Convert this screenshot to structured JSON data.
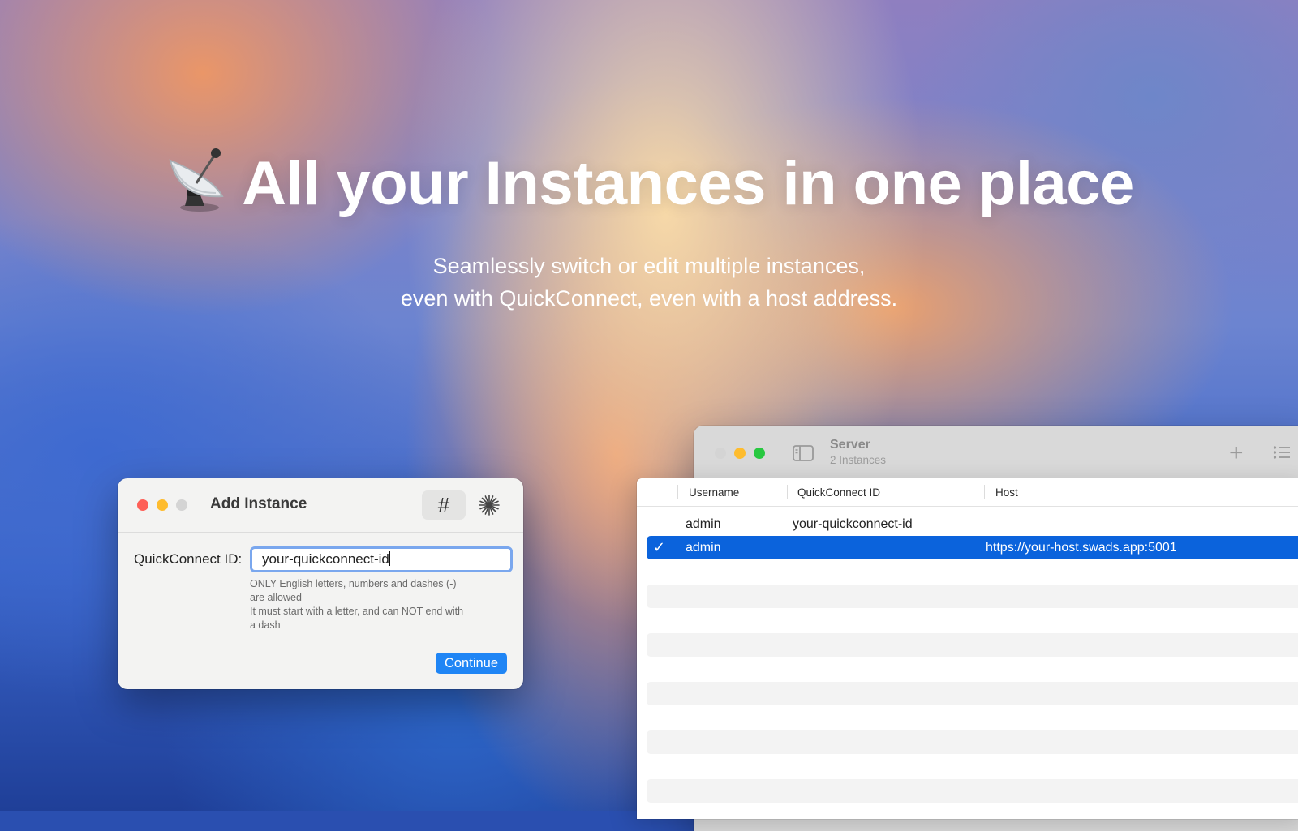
{
  "hero": {
    "title": "All your Instances in one place",
    "subtitle_line1": "Seamlessly switch or edit multiple instances,",
    "subtitle_line2": "even with QuickConnect, even with a host address."
  },
  "add_instance_dialog": {
    "title": "Add Instance",
    "hash_toggle": "#",
    "field_label": "QuickConnect ID:",
    "field_value": "your-quickconnect-id",
    "hint_line1": "ONLY English letters, numbers and dashes (-)",
    "hint_line2": "are allowed",
    "hint_line3": "It must start with a letter, and can NOT end with",
    "hint_line4": "a dash",
    "continue_label": "Continue"
  },
  "server_window": {
    "title": "Server",
    "subtitle": "2 Instances",
    "columns": [
      "Username",
      "QuickConnect ID",
      "Host"
    ],
    "rows": [
      {
        "selected": false,
        "check": "",
        "username": "admin",
        "quickconnect_id": "your-quickconnect-id",
        "host": ""
      },
      {
        "selected": true,
        "check": "✓",
        "username": "admin",
        "quickconnect_id": "",
        "host": "https://your-host.swads.app:5001"
      }
    ]
  },
  "colors": {
    "accent": "#1f85f5",
    "selection": "#0b63dc",
    "close": "#fe5f57",
    "minimize": "#febc2e",
    "zoom": "#28c840"
  },
  "icons": [
    "satellite-dish-icon",
    "hash-icon",
    "sparkle-icon",
    "sidebar-toggle-icon",
    "plus-icon",
    "list-icon",
    "checkmark-icon"
  ]
}
